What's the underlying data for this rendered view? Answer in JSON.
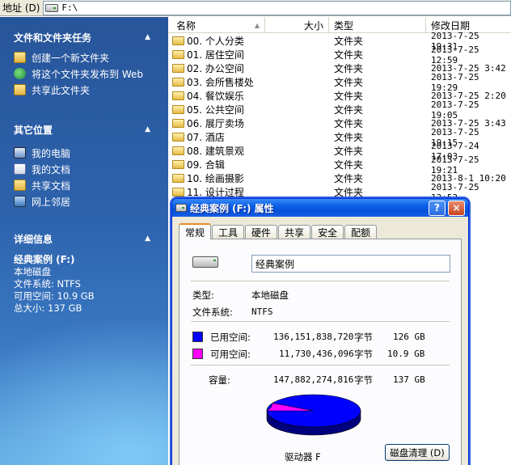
{
  "address": {
    "label": "地址 (D)",
    "path": "F:\\"
  },
  "colors": {
    "used": "#0000ff",
    "free": "#ff00ff"
  },
  "left": {
    "tasks": {
      "title": "文件和文件夹任务",
      "items": [
        {
          "label": "创建一个新文件夹",
          "icon": "new-folder-icon"
        },
        {
          "label": "将这个文件夹发布到 Web",
          "icon": "web-publish-icon"
        },
        {
          "label": "共享此文件夹",
          "icon": "share-folder-icon"
        }
      ]
    },
    "places": {
      "title": "其它位置",
      "items": [
        {
          "label": "我的电脑",
          "icon": "my-computer-icon"
        },
        {
          "label": "我的文档",
          "icon": "my-documents-icon"
        },
        {
          "label": "共享文档",
          "icon": "shared-documents-icon"
        },
        {
          "label": "网上邻居",
          "icon": "network-places-icon"
        }
      ]
    },
    "details": {
      "title": "详细信息",
      "name": "经典案例 (F:)",
      "type": "本地磁盘",
      "fs": "文件系统: NTFS",
      "free": "可用空间: 10.9 GB",
      "total": "总大小: 137 GB"
    }
  },
  "list": {
    "columns": {
      "name": "名称",
      "size": "大小",
      "type": "类型",
      "modified": "修改日期"
    },
    "rows": [
      {
        "name": "00. 个人分类",
        "type": "文件夹",
        "modified": "2013-7-25 19:31"
      },
      {
        "name": "01. 居住空间",
        "type": "文件夹",
        "modified": "2013-7-25 12:59"
      },
      {
        "name": "02. 办公空间",
        "type": "文件夹",
        "modified": "2013-7-25 3:42"
      },
      {
        "name": "03. 会所售楼处",
        "type": "文件夹",
        "modified": "2013-7-25 19:29"
      },
      {
        "name": "04. 餐饮娱乐",
        "type": "文件夹",
        "modified": "2013-7-25 2:20"
      },
      {
        "name": "05. 公共空间",
        "type": "文件夹",
        "modified": "2013-7-25 19:05"
      },
      {
        "name": "06. 展厅卖场",
        "type": "文件夹",
        "modified": "2013-7-25 3:43"
      },
      {
        "name": "07. 酒店",
        "type": "文件夹",
        "modified": "2013-7-25 19:15"
      },
      {
        "name": "08. 建筑景观",
        "type": "文件夹",
        "modified": "2013-7-24 17:03"
      },
      {
        "name": "09. 合辑",
        "type": "文件夹",
        "modified": "2013-7-25 19:21"
      },
      {
        "name": "10. 绘画摄影",
        "type": "文件夹",
        "modified": "2013-8-1 10:20"
      },
      {
        "name": "11. 设计过程",
        "type": "文件夹",
        "modified": "2013-7-25 13:53"
      }
    ]
  },
  "dialog": {
    "title": "经典案例 (F:) 属性",
    "help": "?",
    "close": "×",
    "tabs": [
      "常规",
      "工具",
      "硬件",
      "共享",
      "安全",
      "配额"
    ],
    "active_tab": 0,
    "name_value": "经典案例",
    "type_label": "类型:",
    "type_value": "本地磁盘",
    "fs_label": "文件系统:",
    "fs_value": "NTFS",
    "used_label": "已用空间:",
    "used_bytes": "136,151,838,720",
    "used_unit": "字节",
    "used_gb": "126 GB",
    "free_label": "可用空间:",
    "free_bytes": "11,730,436,096",
    "free_unit": "字节",
    "free_gb": "10.9 GB",
    "cap_label": "容量:",
    "cap_bytes": "147,882,274,816",
    "cap_unit": "字节",
    "cap_gb": "137 GB",
    "drive_label": "驱动器 F",
    "cleanup": "磁盘清理 (D)",
    "used_fraction": 0.9207
  }
}
